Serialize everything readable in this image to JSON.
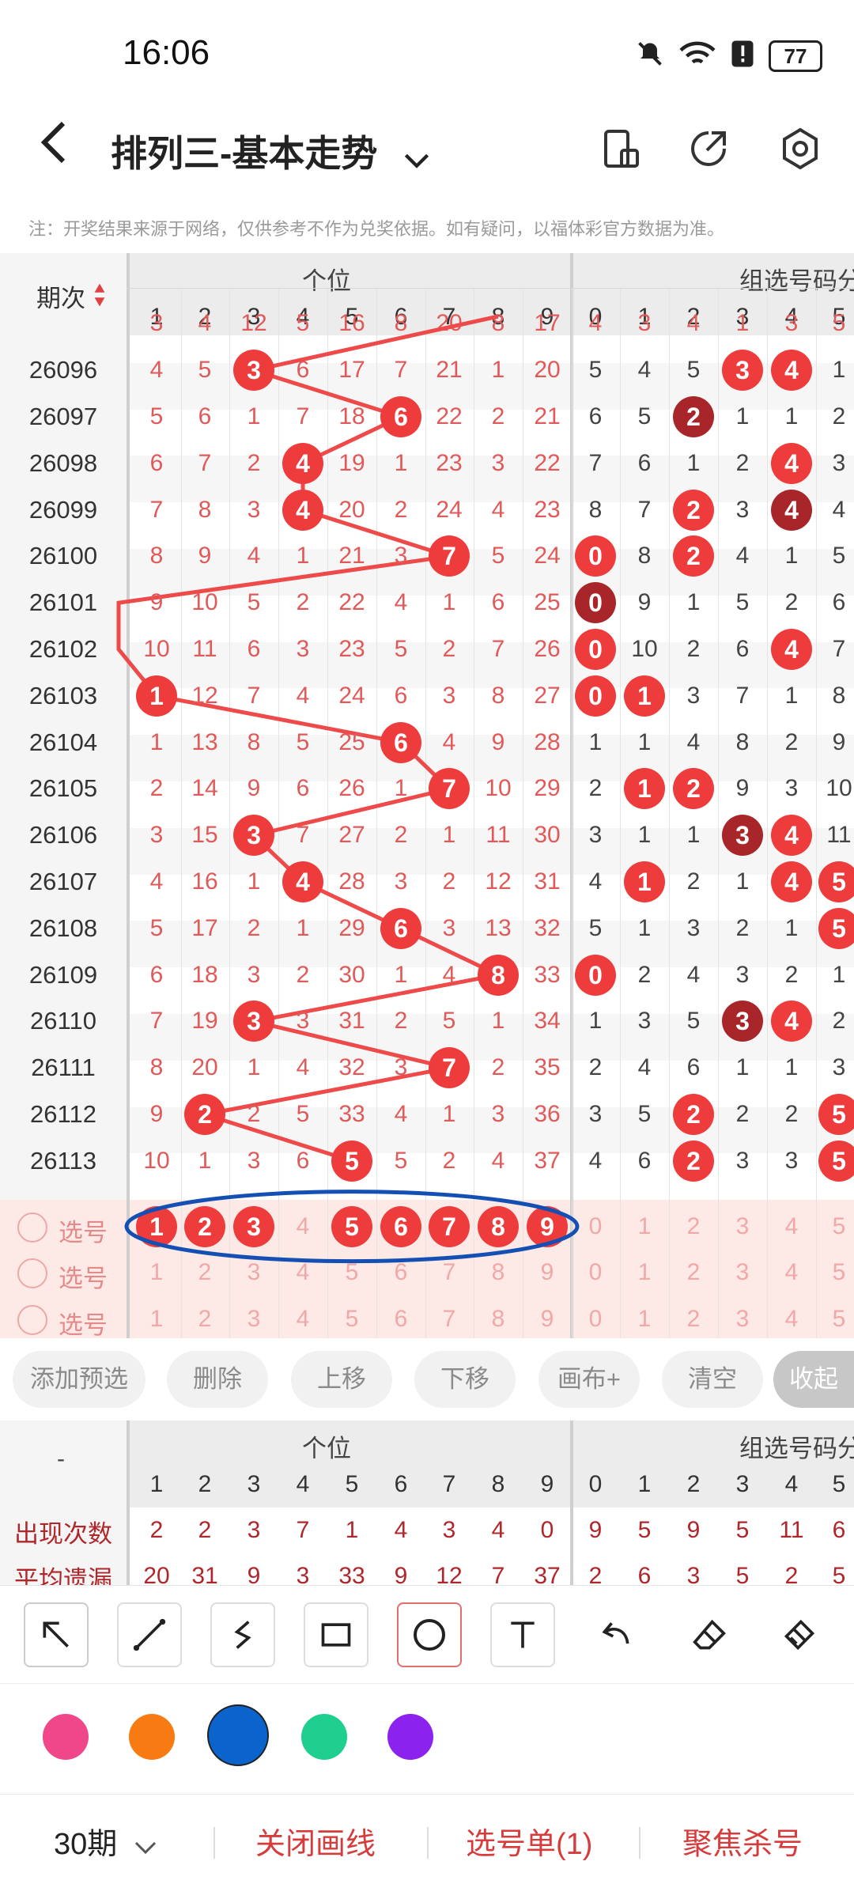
{
  "status": {
    "time": "16:06",
    "battery": "77"
  },
  "header": {
    "title": "排列三-基本走势"
  },
  "note": "注：开奖结果来源于网络，仅供参考不作为兑奖依据。如有疑问，以福体彩官方数据为准。",
  "table": {
    "period_header": "期次",
    "group1_header": "个位",
    "group2_header": "组选号码分",
    "cols1": [
      "1",
      "2",
      "3",
      "4",
      "5",
      "6",
      "7",
      "8",
      "9"
    ],
    "cols2": [
      "0",
      "1",
      "2",
      "3",
      "4",
      "5"
    ],
    "partial_row": [
      "3",
      "4",
      "12",
      "5",
      "16",
      "8",
      "20",
      "8",
      "17",
      "4",
      "3",
      "4",
      "1",
      "3",
      "5"
    ],
    "rows": [
      {
        "period": "26096",
        "g1": [
          "4",
          "5",
          "3",
          "6",
          "17",
          "7",
          "21",
          "1",
          "20"
        ],
        "g2": [
          "5",
          "4",
          "5",
          "3",
          "4",
          "1"
        ],
        "hit": 3,
        "g2hits": {
          "3": "r",
          "4": "r"
        }
      },
      {
        "period": "26097",
        "g1": [
          "5",
          "6",
          "1",
          "7",
          "18",
          "6",
          "22",
          "2",
          "21"
        ],
        "g2": [
          "6",
          "5",
          "2",
          "1",
          "1",
          "2"
        ],
        "hit": 6,
        "g2hits": {
          "2": "d"
        }
      },
      {
        "period": "26098",
        "g1": [
          "6",
          "7",
          "2",
          "4",
          "19",
          "1",
          "23",
          "3",
          "22"
        ],
        "g2": [
          "7",
          "6",
          "1",
          "2",
          "4",
          "3"
        ],
        "hit": 4,
        "g2hits": {
          "4": "r"
        }
      },
      {
        "period": "26099",
        "g1": [
          "7",
          "8",
          "3",
          "4",
          "20",
          "2",
          "24",
          "4",
          "23"
        ],
        "g2": [
          "8",
          "7",
          "2",
          "3",
          "4",
          "4"
        ],
        "hit": 4,
        "g2hits": {
          "2": "r",
          "4": "d"
        }
      },
      {
        "period": "26100",
        "g1": [
          "8",
          "9",
          "4",
          "1",
          "21",
          "3",
          "7",
          "5",
          "24"
        ],
        "g2": [
          "0",
          "8",
          "2",
          "4",
          "1",
          "5"
        ],
        "hit": 7,
        "g2hits": {
          "0": "r",
          "2": "r"
        }
      },
      {
        "period": "26101",
        "g1": [
          "9",
          "10",
          "5",
          "2",
          "22",
          "4",
          "1",
          "6",
          "25"
        ],
        "g2": [
          "0",
          "9",
          "1",
          "5",
          "2",
          "6"
        ],
        "hit": 0,
        "g2hits": {
          "0": "d"
        }
      },
      {
        "period": "26102",
        "g1": [
          "10",
          "11",
          "6",
          "3",
          "23",
          "5",
          "2",
          "7",
          "26"
        ],
        "g2": [
          "0",
          "10",
          "2",
          "6",
          "4",
          "7"
        ],
        "hit": 0,
        "g2hits": {
          "0": "r",
          "4": "r"
        }
      },
      {
        "period": "26103",
        "g1": [
          "1",
          "12",
          "7",
          "4",
          "24",
          "6",
          "3",
          "8",
          "27"
        ],
        "g2": [
          "0",
          "1",
          "3",
          "7",
          "1",
          "8"
        ],
        "hit": 1,
        "g2hits": {
          "0": "r",
          "1": "r"
        }
      },
      {
        "period": "26104",
        "g1": [
          "1",
          "13",
          "8",
          "5",
          "25",
          "6",
          "4",
          "9",
          "28"
        ],
        "g2": [
          "1",
          "1",
          "4",
          "8",
          "2",
          "9"
        ],
        "hit": 6,
        "g2hits": {}
      },
      {
        "period": "26105",
        "g1": [
          "2",
          "14",
          "9",
          "6",
          "26",
          "1",
          "7",
          "10",
          "29"
        ],
        "g2": [
          "2",
          "1",
          "2",
          "9",
          "3",
          "10"
        ],
        "hit": 7,
        "g2hits": {
          "1": "r",
          "2": "r"
        }
      },
      {
        "period": "26106",
        "g1": [
          "3",
          "15",
          "3",
          "7",
          "27",
          "2",
          "1",
          "11",
          "30"
        ],
        "g2": [
          "3",
          "1",
          "1",
          "3",
          "4",
          "11"
        ],
        "hit": 3,
        "g2hits": {
          "3": "d",
          "4": "r"
        }
      },
      {
        "period": "26107",
        "g1": [
          "4",
          "16",
          "1",
          "4",
          "28",
          "3",
          "2",
          "12",
          "31"
        ],
        "g2": [
          "4",
          "1",
          "2",
          "1",
          "4",
          "5"
        ],
        "hit": 4,
        "g2hits": {
          "1": "r",
          "4": "r",
          "5": "r"
        }
      },
      {
        "period": "26108",
        "g1": [
          "5",
          "17",
          "2",
          "1",
          "29",
          "6",
          "3",
          "13",
          "32"
        ],
        "g2": [
          "5",
          "1",
          "3",
          "2",
          "1",
          "5"
        ],
        "hit": 6,
        "g2hits": {
          "5": "r"
        }
      },
      {
        "period": "26109",
        "g1": [
          "6",
          "18",
          "3",
          "2",
          "30",
          "1",
          "4",
          "8",
          "33"
        ],
        "g2": [
          "0",
          "2",
          "4",
          "3",
          "2",
          "1"
        ],
        "hit": 8,
        "g2hits": {
          "0": "r"
        }
      },
      {
        "period": "26110",
        "g1": [
          "7",
          "19",
          "3",
          "3",
          "31",
          "2",
          "5",
          "1",
          "34"
        ],
        "g2": [
          "1",
          "3",
          "5",
          "3",
          "4",
          "2"
        ],
        "hit": 3,
        "g2hits": {
          "3": "d",
          "4": "r"
        }
      },
      {
        "period": "26111",
        "g1": [
          "8",
          "20",
          "1",
          "4",
          "32",
          "3",
          "7",
          "2",
          "35"
        ],
        "g2": [
          "2",
          "4",
          "6",
          "1",
          "1",
          "3"
        ],
        "hit": 7,
        "g2hits": {}
      },
      {
        "period": "26112",
        "g1": [
          "9",
          "2",
          "2",
          "5",
          "33",
          "4",
          "1",
          "3",
          "36"
        ],
        "g2": [
          "3",
          "5",
          "2",
          "2",
          "2",
          "5"
        ],
        "hit": 2,
        "g2hits": {
          "2": "r",
          "5": "r"
        }
      },
      {
        "period": "26113",
        "g1": [
          "10",
          "1",
          "3",
          "6",
          "5",
          "5",
          "2",
          "4",
          "37"
        ],
        "g2": [
          "4",
          "6",
          "2",
          "3",
          "3",
          "5"
        ],
        "hit": 5,
        "g2hits": {
          "2": "r",
          "5": "r"
        }
      }
    ],
    "select_label": "选号",
    "select_row1_selected": [
      "1",
      "2",
      "3",
      "5",
      "6",
      "7",
      "8",
      "9"
    ],
    "select_values": [
      "1",
      "2",
      "3",
      "4",
      "5",
      "6",
      "7",
      "8",
      "9",
      "0",
      "1",
      "2",
      "3",
      "4",
      "5"
    ]
  },
  "actions": [
    "添加预选",
    "删除",
    "上移",
    "下移",
    "画布+",
    "清空",
    "收起"
  ],
  "stats": {
    "dash": "-",
    "group1_header": "个位",
    "group2_header": "组选号码分",
    "row1_label": "出现次数",
    "row1": [
      "2",
      "2",
      "3",
      "7",
      "1",
      "4",
      "3",
      "4",
      "0",
      "9",
      "5",
      "9",
      "5",
      "11",
      "6"
    ],
    "row2_label": "平均遗漏",
    "row2": [
      "20",
      "31",
      "9",
      "3",
      "33",
      "9",
      "12",
      "7",
      "37",
      "2",
      "6",
      "3",
      "5",
      "2",
      "5"
    ]
  },
  "colors": {
    "pink": "#f0468a",
    "orange": "#f77a12",
    "blue": "#0a64cc",
    "green": "#1ecf8f",
    "purple": "#8b22ee",
    "hit_red": "#ee3b3b",
    "hit_dark": "#a8262a",
    "circle_outline": "#1450b4"
  },
  "bottom": {
    "periods": "30期",
    "close_draw": "关闭画线",
    "select_list": "选号单(1)",
    "focus_kill": "聚焦杀号"
  }
}
